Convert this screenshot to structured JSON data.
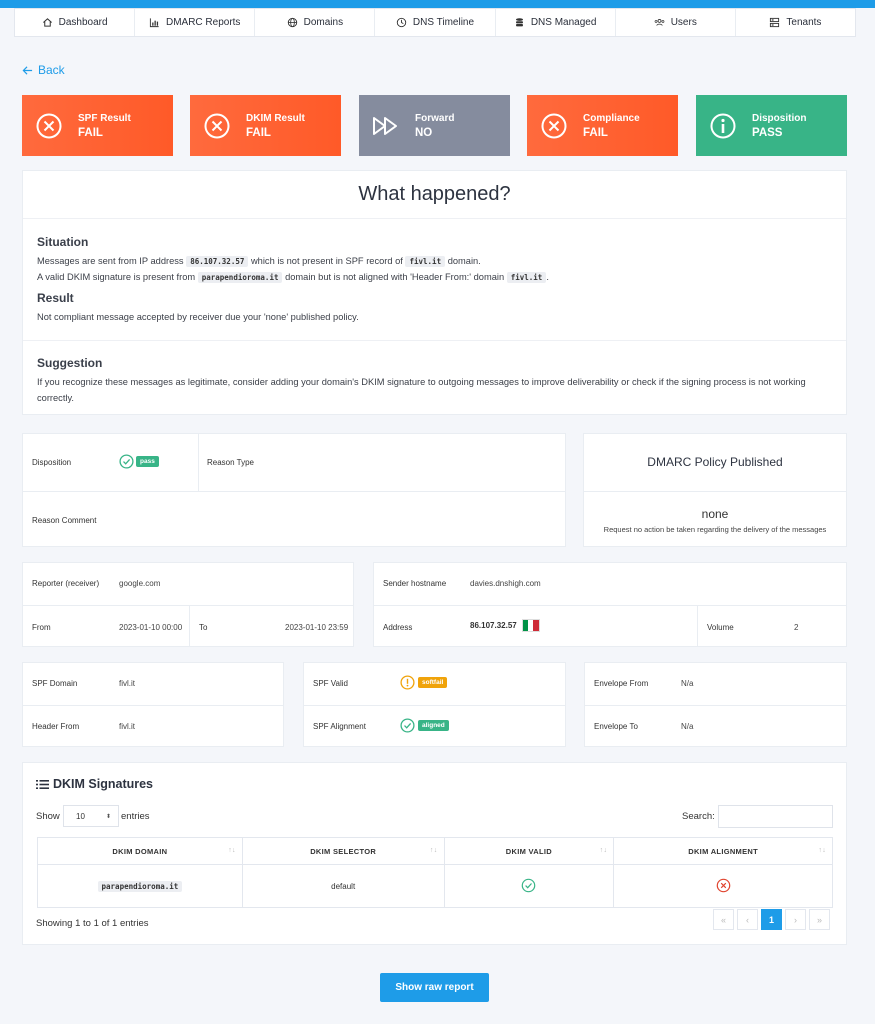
{
  "nav": [
    {
      "label": "Dashboard",
      "icon": "home-icon"
    },
    {
      "label": "DMARC Reports",
      "icon": "bar-chart-icon"
    },
    {
      "label": "Domains",
      "icon": "globe-icon"
    },
    {
      "label": "DNS Timeline",
      "icon": "clock-icon"
    },
    {
      "label": "DNS Managed",
      "icon": "database-icon"
    },
    {
      "label": "Users",
      "icon": "users-icon"
    },
    {
      "label": "Tenants",
      "icon": "tenants-icon"
    }
  ],
  "back_label": "Back",
  "cards": [
    {
      "label": "SPF Result",
      "value": "FAIL"
    },
    {
      "label": "DKIM Result",
      "value": "FAIL"
    },
    {
      "label": "Forward",
      "value": "NO"
    },
    {
      "label": "Compliance",
      "value": "FAIL"
    },
    {
      "label": "Disposition",
      "value": "PASS"
    }
  ],
  "what": {
    "title": "What happened?",
    "situation_h": "Situation",
    "s1a": "Messages are sent from IP address",
    "s1ip": "86.107.32.57",
    "s1b": "which is not present in SPF record of",
    "s1dom": "fivl.it",
    "s1c": "domain.",
    "s2a": "A valid DKIM signature is present from",
    "s2dom": "parapendioroma.it",
    "s2b": "domain but is not aligned with 'Header From:' domain",
    "s2hf": "fivl.it",
    "s2c": ".",
    "result_h": "Result",
    "result_p": "Not compliant message accepted by receiver due your 'none' published policy.",
    "suggestion_h": "Suggestion",
    "suggestion_p": "If you recognize these messages as legitimate, consider adding your domain's DKIM signature to outgoing messages to improve deliverability or check if the signing process is not working correctly."
  },
  "disp": {
    "disposition_label": "Disposition",
    "disposition_badge": "pass",
    "reason_type_label": "Reason Type",
    "reason_comment_label": "Reason Comment"
  },
  "policy": {
    "title": "DMARC Policy Published",
    "value": "none",
    "desc": "Request no action be taken regarding the delivery of the messages"
  },
  "report": {
    "reporter_label": "Reporter (receiver)",
    "reporter_value": "google.com",
    "from_label": "From",
    "from_value": "2023-01-10 00:00",
    "to_label": "To",
    "to_value": "2023-01-10 23:59"
  },
  "sender": {
    "hostname_label": "Sender hostname",
    "hostname_value": "davies.dnshigh.com",
    "address_label": "Address",
    "address_value": "86.107.32.57",
    "volume_label": "Volume",
    "volume_value": "2",
    "flag_colors": [
      "#009246",
      "#ffffff",
      "#ce2b37"
    ]
  },
  "spf": {
    "domain_label": "SPF Domain",
    "domain_value": "fivl.it",
    "header_from_label": "Header From",
    "header_from_value": "fivl.it",
    "valid_label": "SPF Valid",
    "valid_badge": "softfail",
    "alignment_label": "SPF Alignment",
    "alignment_badge": "aligned",
    "env_from_label": "Envelope From",
    "env_from_value": "N/a",
    "env_to_label": "Envelope To",
    "env_to_value": "N/a"
  },
  "dkim": {
    "title": "DKIM Signatures",
    "show": "Show",
    "entries_value": "10",
    "entries": "entries",
    "search_label": "Search:",
    "columns": [
      "DKIM DOMAIN",
      "DKIM SELECTOR",
      "DKIM VALID",
      "DKIM ALIGNMENT"
    ],
    "rows": [
      {
        "domain": "parapendioroma.it",
        "selector": "default",
        "valid": "check",
        "alignment": "cross"
      }
    ],
    "info": "Showing 1 to 1 of 1 entries",
    "pagination": [
      "«",
      "‹",
      "1",
      "›",
      "»"
    ]
  },
  "raw_button": "Show raw report",
  "colors": {
    "accent": "#1e9ce8",
    "fail": "#ff5e2e",
    "neutral": "#858c9e",
    "pass": "#38b487",
    "warn": "#f0a30a",
    "error": "#e0442f"
  }
}
